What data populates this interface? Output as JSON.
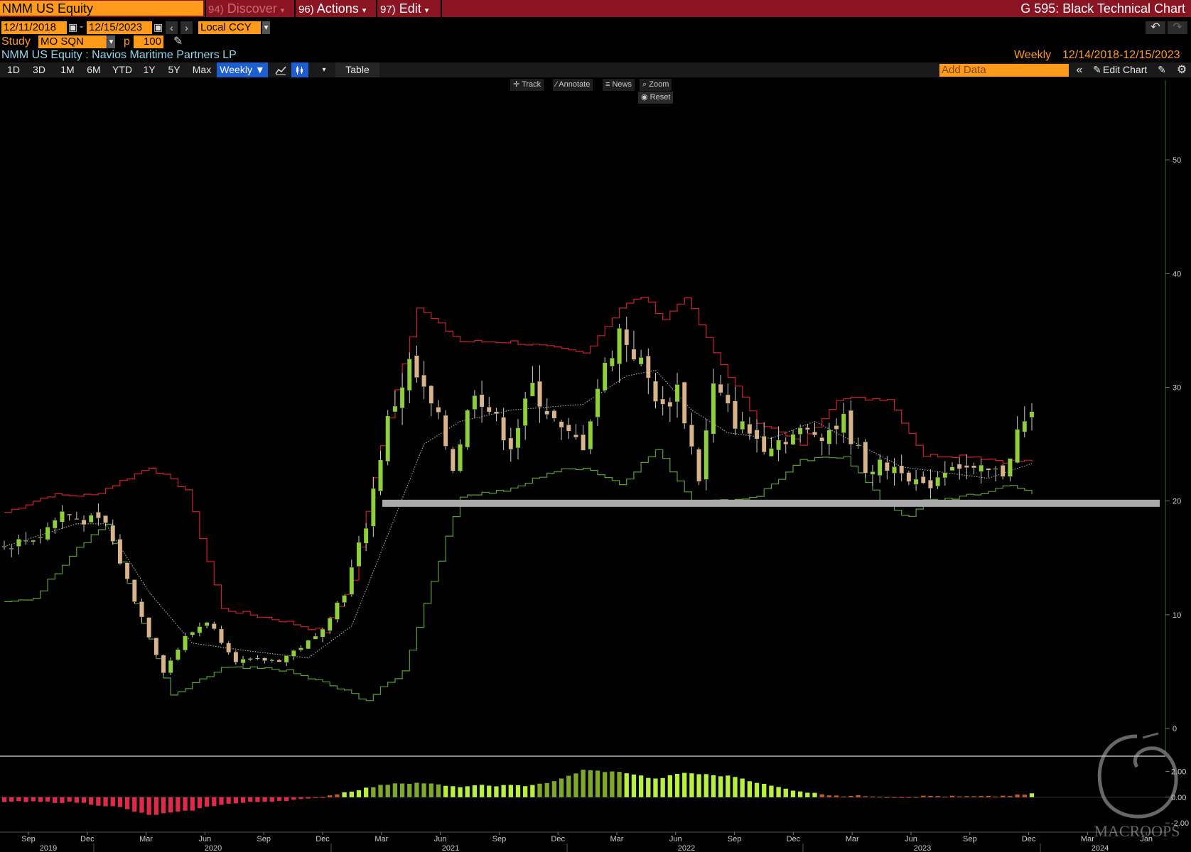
{
  "topbar": {
    "ticker": "NMM US Equity",
    "discover": {
      "num": "94)",
      "label": "Discover"
    },
    "actions": {
      "num": "96)",
      "label": "Actions"
    },
    "edit": {
      "num": "97)",
      "label": "Edit"
    },
    "title": "G 595: Black Technical Chart"
  },
  "range": {
    "start": "12/11/2018",
    "dash": "-",
    "end": "12/15/2023",
    "currency": "Local CCY"
  },
  "study": {
    "label": "Study",
    "value": "MO SQN",
    "p_label": "p",
    "p_value": "100"
  },
  "security": {
    "name": "NMM US Equity : Navios Maritime Partners LP",
    "frequency": "Weekly",
    "date_range": "12/14/2018-12/15/2023"
  },
  "toolbar": {
    "periods": [
      "1D",
      "3D",
      "1M",
      "6M",
      "YTD",
      "1Y",
      "5Y",
      "Max"
    ],
    "frequency": "Weekly ▼",
    "table": "Table",
    "add_data_placeholder": "Add Data",
    "edit_chart": "Edit Chart"
  },
  "float_tools": {
    "track": "Track",
    "annotate": "Annotate",
    "news": "News",
    "zoom": "Zoom",
    "reset": "Reset"
  },
  "watermark": "MACROOPS",
  "colors": {
    "up": "#8fcf3a",
    "down": "#d9b48a",
    "upper_band": "#d01e2e",
    "lower_band": "#5aa02a",
    "support": "#aaaaaa",
    "osc_pos": "#b8f040",
    "osc_neg": "#e02848"
  },
  "chart_data": [
    {
      "type": "candlestick",
      "frequency": "Weekly",
      "y_ticks": [
        0,
        10,
        20,
        30,
        40,
        50
      ],
      "ylim": [
        0,
        57
      ],
      "x_tick_months": [
        "Sep",
        "Dec",
        "Mar",
        "Jun",
        "Sep",
        "Dec",
        "Mar",
        "Jun",
        "Sep",
        "Dec",
        "Mar",
        "Jun",
        "Sep",
        "Dec",
        "Mar",
        "Jun",
        "Sep",
        "Dec",
        "Mar",
        "Jan"
      ],
      "x_tick_years": [
        "2019",
        "2020",
        "2021",
        "2022",
        "2023",
        "2024"
      ],
      "support_level": 19.8,
      "close_anchors": [
        [
          0,
          16
        ],
        [
          5,
          17
        ],
        [
          8,
          19
        ],
        [
          10,
          18.5
        ],
        [
          14,
          18
        ],
        [
          17,
          13
        ],
        [
          22,
          5
        ],
        [
          25,
          8
        ],
        [
          28,
          9.5
        ],
        [
          32,
          6
        ],
        [
          38,
          6
        ],
        [
          43,
          8
        ],
        [
          47,
          12
        ],
        [
          50,
          18
        ],
        [
          53,
          27
        ],
        [
          56,
          32
        ],
        [
          60,
          27
        ],
        [
          62,
          23
        ],
        [
          65,
          30
        ],
        [
          70,
          25
        ],
        [
          73,
          30
        ],
        [
          77,
          26
        ],
        [
          80,
          25
        ],
        [
          82,
          30
        ],
        [
          85,
          35
        ],
        [
          88,
          32
        ],
        [
          91,
          28
        ],
        [
          93,
          30
        ],
        [
          96,
          22
        ],
        [
          98,
          30
        ],
        [
          101,
          27
        ],
        [
          105,
          25
        ],
        [
          110,
          26
        ],
        [
          113,
          26
        ],
        [
          116,
          27
        ],
        [
          119,
          23
        ],
        [
          124,
          23
        ],
        [
          127,
          21
        ],
        [
          131,
          23.5
        ],
        [
          134,
          22.5
        ],
        [
          138,
          22.5
        ],
        [
          140,
          26
        ],
        [
          142,
          27.5
        ]
      ],
      "upper_band_anchors": [
        [
          0,
          19
        ],
        [
          6,
          20.5
        ],
        [
          12,
          20.5
        ],
        [
          20,
          23
        ],
        [
          25,
          21
        ],
        [
          30,
          10.5
        ],
        [
          38,
          9.5
        ],
        [
          44,
          8.5
        ],
        [
          48,
          13
        ],
        [
          52,
          25
        ],
        [
          57,
          37
        ],
        [
          63,
          34
        ],
        [
          70,
          34
        ],
        [
          80,
          33
        ],
        [
          85,
          37
        ],
        [
          88,
          38
        ],
        [
          91,
          36
        ],
        [
          94,
          38
        ],
        [
          98,
          33
        ],
        [
          104,
          27
        ],
        [
          110,
          25
        ],
        [
          115,
          29
        ],
        [
          122,
          29
        ],
        [
          127,
          24
        ],
        [
          133,
          24
        ],
        [
          138,
          23.5
        ],
        [
          142,
          23.5
        ]
      ],
      "lower_band_anchors": [
        [
          0,
          11
        ],
        [
          4,
          11.5
        ],
        [
          10,
          16
        ],
        [
          14,
          18
        ],
        [
          18,
          11
        ],
        [
          23,
          2.8
        ],
        [
          30,
          5.3
        ],
        [
          38,
          5.2
        ],
        [
          44,
          4
        ],
        [
          50,
          2.5
        ],
        [
          55,
          5
        ],
        [
          59,
          13
        ],
        [
          63,
          20.5
        ],
        [
          70,
          21
        ],
        [
          75,
          22.5
        ],
        [
          80,
          23
        ],
        [
          85,
          21.5
        ],
        [
          90,
          24.5
        ],
        [
          95,
          20
        ],
        [
          100,
          20
        ],
        [
          104,
          20.5
        ],
        [
          110,
          23.5
        ],
        [
          116,
          24
        ],
        [
          121,
          20
        ],
        [
          125,
          18.5
        ],
        [
          127,
          20
        ],
        [
          134,
          20.5
        ],
        [
          139,
          21.5
        ],
        [
          142,
          20.5
        ]
      ],
      "mid_anchors": [
        [
          0,
          16
        ],
        [
          10,
          18
        ],
        [
          14,
          18
        ],
        [
          20,
          12
        ],
        [
          26,
          7.5
        ],
        [
          34,
          6.8
        ],
        [
          42,
          6.2
        ],
        [
          48,
          9
        ],
        [
          53,
          17
        ],
        [
          58,
          25
        ],
        [
          63,
          27
        ],
        [
          70,
          28
        ],
        [
          80,
          28.5
        ],
        [
          86,
          31
        ],
        [
          90,
          31.5
        ],
        [
          95,
          28
        ],
        [
          100,
          26
        ],
        [
          106,
          25.5
        ],
        [
          112,
          27
        ],
        [
          118,
          25
        ],
        [
          124,
          23
        ],
        [
          130,
          22.5
        ],
        [
          136,
          22
        ],
        [
          142,
          23.3
        ]
      ],
      "n_weeks": 143
    },
    {
      "type": "bar",
      "name": "MO SQN",
      "y_ticks": [
        "2.00",
        "0.00",
        "-2.00"
      ],
      "ylim": [
        -2.6,
        2.8
      ],
      "value_anchors": [
        [
          0,
          -0.35
        ],
        [
          10,
          -0.4
        ],
        [
          16,
          -0.8
        ],
        [
          20,
          -1.4
        ],
        [
          25,
          -1.1
        ],
        [
          30,
          -0.55
        ],
        [
          37,
          -0.3
        ],
        [
          42,
          -0.15
        ],
        [
          45,
          0.15
        ],
        [
          50,
          0.7
        ],
        [
          54,
          1.1
        ],
        [
          58,
          1.1
        ],
        [
          62,
          0.8
        ],
        [
          66,
          0.9
        ],
        [
          72,
          0.9
        ],
        [
          76,
          1.2
        ],
        [
          80,
          2.1
        ],
        [
          86,
          1.9
        ],
        [
          90,
          1.4
        ],
        [
          94,
          1.9
        ],
        [
          98,
          1.7
        ],
        [
          101,
          1.6
        ],
        [
          105,
          1.0
        ],
        [
          108,
          0.65
        ],
        [
          112,
          0.3
        ],
        [
          116,
          0.1
        ],
        [
          120,
          0.1
        ],
        [
          124,
          0.0
        ],
        [
          128,
          0.1
        ],
        [
          132,
          0.05
        ],
        [
          136,
          0.05
        ],
        [
          140,
          0.15
        ],
        [
          142,
          0.25
        ]
      ],
      "green_shades": [
        [
          51,
          60
        ],
        [
          74,
          85
        ]
      ]
    }
  ]
}
